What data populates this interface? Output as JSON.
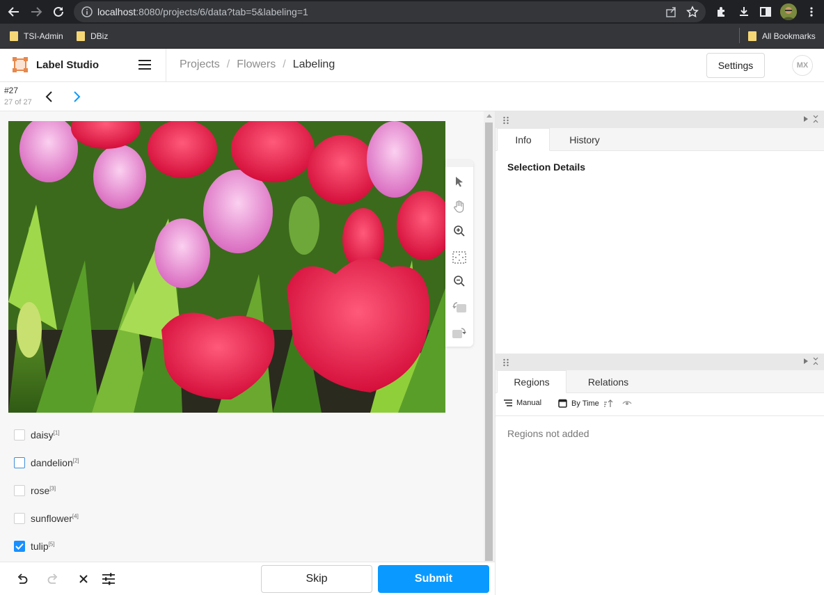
{
  "browser": {
    "url_host": "localhost",
    "url_rest": ":8080/projects/6/data?tab=5&labeling=1",
    "bookmarks": [
      "TSI-Admin",
      "DBiz"
    ],
    "all_bookmarks": "All Bookmarks"
  },
  "header": {
    "brand": "Label Studio",
    "breadcrumbs": [
      "Projects",
      "Flowers",
      "Labeling"
    ],
    "settings_label": "Settings",
    "avatar_initials": "MX"
  },
  "task": {
    "id": "#27",
    "position": "27 of 27"
  },
  "choices": [
    {
      "label": "daisy",
      "hotkey": "[1]",
      "checked": false
    },
    {
      "label": "dandelion",
      "hotkey": "[2]",
      "checked": false
    },
    {
      "label": "rose",
      "hotkey": "[3]",
      "checked": false
    },
    {
      "label": "sunflower",
      "hotkey": "[4]",
      "checked": false
    },
    {
      "label": "tulip",
      "hotkey": "[5]",
      "checked": true
    }
  ],
  "actions": {
    "skip": "Skip",
    "submit": "Submit"
  },
  "info_panel": {
    "tabs": [
      "Info",
      "History"
    ],
    "title": "Selection Details"
  },
  "regions_panel": {
    "tabs": [
      "Regions",
      "Relations"
    ],
    "group_label": "Manual",
    "sort_label": "By Time",
    "empty_text": "Regions not added"
  },
  "colors": {
    "accent": "#0a9aff",
    "checkbox": "#1890ff",
    "brand": "#e8884a"
  }
}
